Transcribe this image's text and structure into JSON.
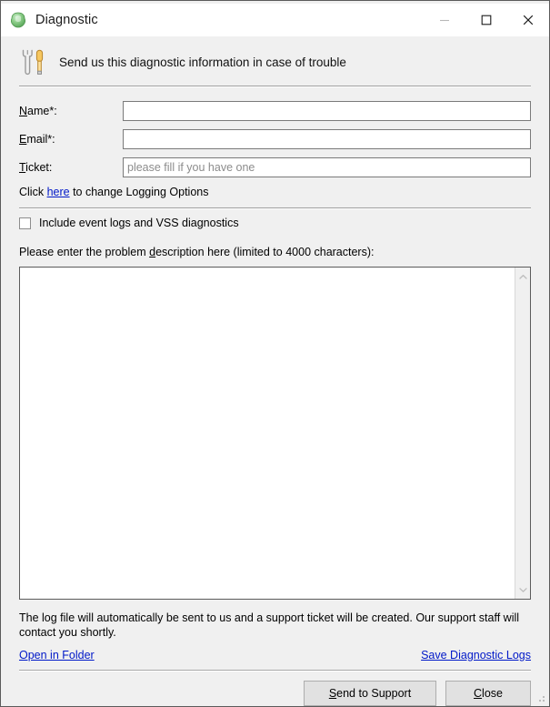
{
  "window": {
    "title": "Diagnostic",
    "app_icon": "green-sphere-icon",
    "controls": {
      "minimize": "minimize-icon",
      "maximize": "maximize-icon",
      "close": "close-icon"
    }
  },
  "header": {
    "icon": "wrench-screwdriver-icon",
    "text": "Send us this diagnostic information in case of trouble"
  },
  "form": {
    "name": {
      "label": "Name*:",
      "label_mnemonic": "N",
      "label_rest": "ame*:",
      "value": "",
      "placeholder": ""
    },
    "email": {
      "label": "Email*:",
      "label_mnemonic": "E",
      "label_rest": "mail*:",
      "value": "",
      "placeholder": ""
    },
    "ticket": {
      "label": "Ticket:",
      "label_mnemonic": "T",
      "label_rest": "icket:",
      "value": "",
      "placeholder": "please fill if you have one"
    },
    "logging_hint": {
      "prefix": "Click ",
      "link": "here",
      "suffix": " to change Logging Options"
    }
  },
  "options": {
    "include_logs": {
      "label": "Include event logs and VSS diagnostics",
      "checked": false
    }
  },
  "description": {
    "label_prefix": "Please enter the problem ",
    "label_mnemonic": "d",
    "label_rest": "escription here (limited to 4000 characters):",
    "value": "",
    "placeholder": "",
    "max_characters": 4000
  },
  "footer": {
    "note": "The log file will automatically be sent to us and a support ticket will be created. Our support staff will contact you shortly.",
    "open_folder_link": "Open in Folder",
    "save_logs_link": "Save Diagnostic Logs"
  },
  "buttons": {
    "send": {
      "mnemonic": "S",
      "rest": "end to Support"
    },
    "close": {
      "mnemonic": "C",
      "rest": "lose"
    }
  },
  "colors": {
    "dialog_background": "#f0f0f0",
    "titlebar_background": "#ffffff",
    "link": "#0018c8",
    "input_border": "#7a7a7a",
    "textarea_border": "#5b5b5b",
    "placeholder_text": "#8c8c8c",
    "button_face": "#e1e1e1",
    "app_icon_green": "#6fbf6f"
  }
}
